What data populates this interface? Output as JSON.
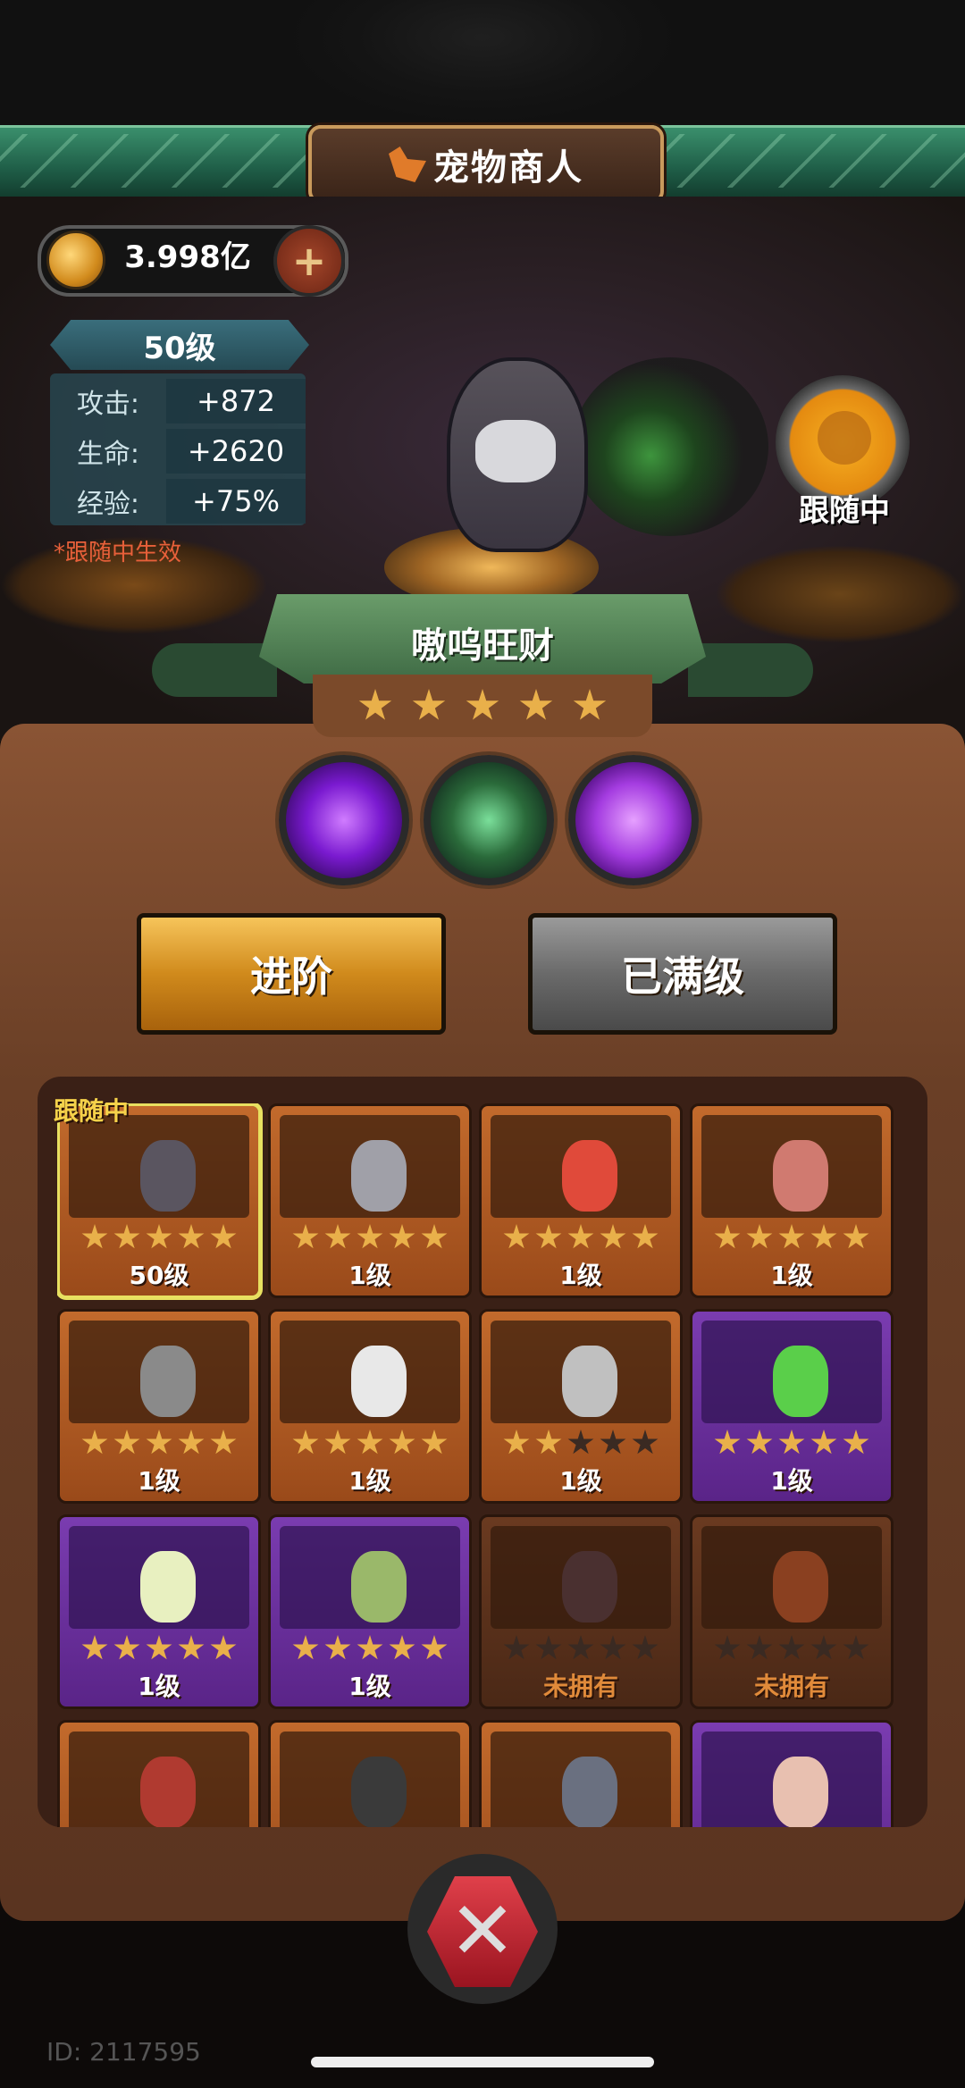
{
  "title": "宠物商人",
  "currency": {
    "value": "3.998亿",
    "plus": "+"
  },
  "level": "50级",
  "stats": [
    {
      "label": "攻击:",
      "value": "+872"
    },
    {
      "label": "生命:",
      "value": "+2620"
    },
    {
      "label": "经验:",
      "value": "+75%"
    }
  ],
  "note": "*跟随中生效",
  "follow_badge": "跟随中",
  "pet_name": "嗷呜旺财",
  "pet_stars": 5,
  "buttons": {
    "advance": "进阶",
    "maxed": "已满级"
  },
  "grid_follow_tag": "跟随中",
  "pets": [
    {
      "level": "50级",
      "stars": 5,
      "style": "orange",
      "color": "#5a5560",
      "selected": true
    },
    {
      "level": "1级",
      "stars": 5,
      "style": "orange",
      "color": "#a0a0a8"
    },
    {
      "level": "1级",
      "stars": 5,
      "style": "orange",
      "color": "#e04a3a"
    },
    {
      "level": "1级",
      "stars": 5,
      "style": "orange",
      "color": "#d07a70"
    },
    {
      "level": "1级",
      "stars": 5,
      "style": "orange",
      "color": "#8a8a8a"
    },
    {
      "level": "1级",
      "stars": 5,
      "style": "orange",
      "color": "#e8e8e8"
    },
    {
      "level": "1级",
      "stars": 2,
      "style": "orange",
      "color": "#c0c0c0"
    },
    {
      "level": "1级",
      "stars": 5,
      "style": "purple",
      "color": "#5acf4a"
    },
    {
      "level": "1级",
      "stars": 5,
      "style": "purple",
      "color": "#e8f0c0"
    },
    {
      "level": "1级",
      "stars": 5,
      "style": "purple",
      "color": "#9ab86a"
    },
    {
      "level": "未拥有",
      "stars": 0,
      "style": "dim",
      "color": "#4a3030"
    },
    {
      "level": "未拥有",
      "stars": 0,
      "style": "dim",
      "color": "#8a4020"
    },
    {
      "level": "",
      "stars": 0,
      "style": "orange",
      "color": "#b03a30"
    },
    {
      "level": "",
      "stars": 0,
      "style": "orange",
      "color": "#3a3a3a"
    },
    {
      "level": "",
      "stars": 0,
      "style": "orange",
      "color": "#6a7080"
    },
    {
      "level": "",
      "stars": 0,
      "style": "purple",
      "color": "#e8c0b0"
    }
  ],
  "close_icon": "✕",
  "id_text": "ID: 2117595"
}
